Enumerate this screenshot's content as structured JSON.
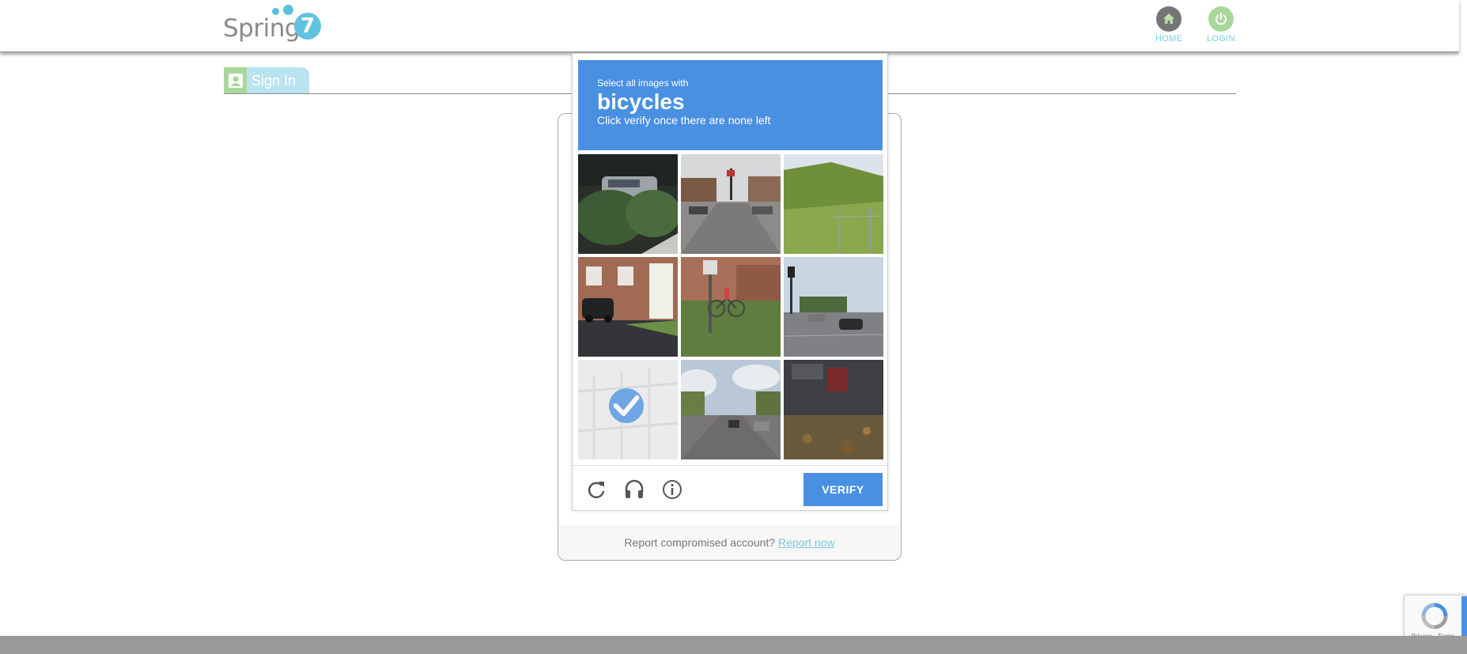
{
  "header": {
    "logo_text": "Spring",
    "logo_number": "7",
    "nav": [
      {
        "label": "HOME",
        "icon": "home-icon"
      },
      {
        "label": "LOGIN",
        "icon": "power-icon"
      }
    ]
  },
  "tab": {
    "label": "Sign In",
    "icon": "user-icon"
  },
  "card": {
    "footer_text": "Report compromised account?",
    "footer_link": "Report now"
  },
  "captcha": {
    "prompt_small": "Select all images with",
    "prompt_target": "bicycles",
    "prompt_sub": "Click verify once there are none left",
    "verify_label": "VERIFY",
    "tiles": [
      {
        "name": "tile-1",
        "selected": false
      },
      {
        "name": "tile-2",
        "selected": false
      },
      {
        "name": "tile-3",
        "selected": false
      },
      {
        "name": "tile-4",
        "selected": false
      },
      {
        "name": "tile-5",
        "selected": false
      },
      {
        "name": "tile-6",
        "selected": false
      },
      {
        "name": "tile-7",
        "selected": true
      },
      {
        "name": "tile-8",
        "selected": false
      },
      {
        "name": "tile-9",
        "selected": false
      }
    ]
  },
  "badge": {
    "links": "Privacy - Terms"
  },
  "colors": {
    "accent": "#4a90e2",
    "brand": "#62c3e1",
    "login_green": "#a9d79b"
  }
}
